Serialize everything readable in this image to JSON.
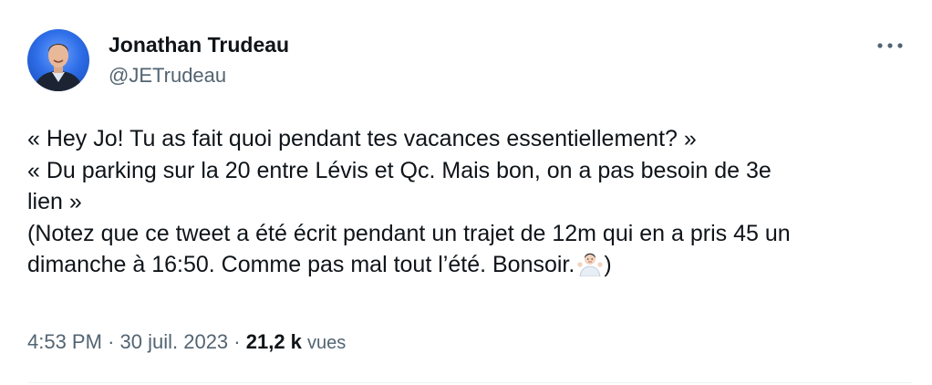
{
  "author": {
    "name": "Jonathan Trudeau",
    "handle": "@JETrudeau"
  },
  "tweet": {
    "lines": [
      "« Hey Jo! Tu as fait quoi pendant tes vacances essentiellement? »",
      "« Du parking sur la 20 entre Lévis et Qc. Mais bon, on a pas besoin de 3e",
      "lien »",
      "(Notez que ce tweet a été écrit pendant un trajet de 12m qui en a pris 45 un",
      "dimanche à 16:50. Comme pas mal tout l’été. Bonsoir.",
      ")"
    ],
    "emoji": "man-shrugging-emoji"
  },
  "meta": {
    "time": "4:53 PM",
    "separator": "·",
    "date": "30 juil. 2023",
    "views_count": "21,2 k",
    "views_label": "vues"
  },
  "icons": {
    "more": "more-options-icon",
    "avatar": "profile-photo"
  },
  "colors": {
    "text_primary": "#0f1419",
    "text_secondary": "#536471",
    "divider": "#eff3f4",
    "avatar_bg": "#2f6fe8"
  }
}
